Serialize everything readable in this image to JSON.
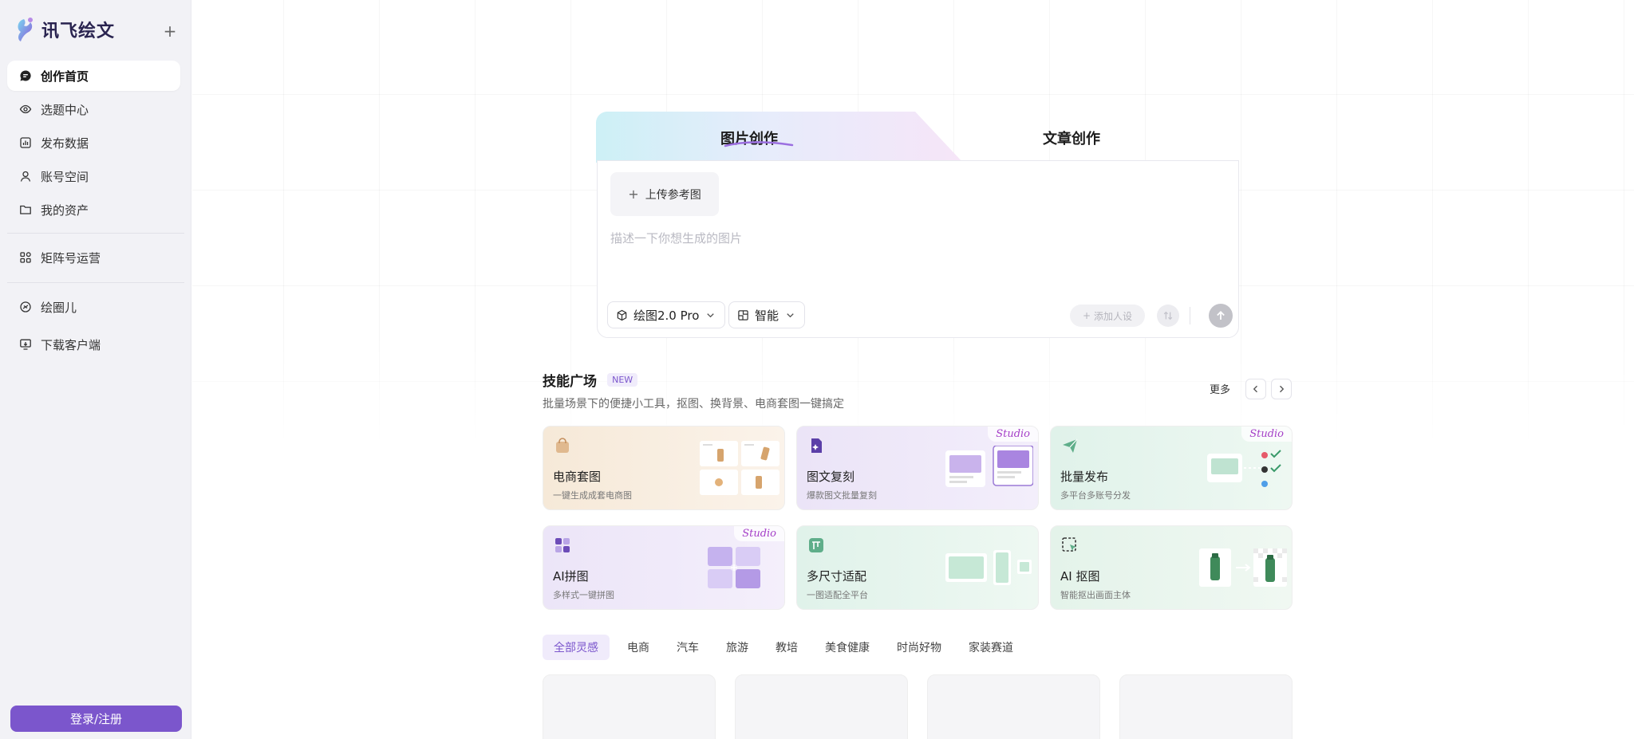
{
  "brand": {
    "name": "讯飞绘文",
    "accent": "#7b56cc"
  },
  "sidebar": {
    "new_button_icon": "plus-icon",
    "items": [
      {
        "label": "创作首页",
        "icon": "chat-bubble-icon",
        "active": true
      },
      {
        "label": "选题中心",
        "icon": "eye-target-icon"
      },
      {
        "label": "发布数据",
        "icon": "bar-chart-icon"
      },
      {
        "label": "账号空间",
        "icon": "user-icon"
      },
      {
        "label": "我的资产",
        "icon": "folder-icon"
      },
      {
        "label": "矩阵号运营",
        "icon": "grid-apps-icon"
      },
      {
        "label": "绘圈儿",
        "icon": "circle-chat-icon"
      },
      {
        "label": "下载客户端",
        "icon": "monitor-download-icon"
      }
    ],
    "login_label": "登录/注册"
  },
  "composer": {
    "tabs": [
      {
        "label": "图片创作",
        "active": true
      },
      {
        "label": "文章创作",
        "active": false
      }
    ],
    "upload_label": "上传参考图",
    "prompt_placeholder": "描述一下你想生成的图片",
    "model_label": "绘图2.0 Pro",
    "ratio_label": "智能",
    "persona_label": "添加人设"
  },
  "skills": {
    "title": "技能广场",
    "badge": "NEW",
    "subtitle": "批量场景下的便捷小工具，抠图、换背景、电商套图一键搞定",
    "more_label": "更多",
    "cards": [
      {
        "title": "电商套图",
        "desc": "一键生成成套电商图",
        "studio": "",
        "bg": "#f6ebdd"
      },
      {
        "title": "图文复刻",
        "desc": "爆款图文批量复刻",
        "studio": "Studio",
        "bg": "#ece6f7"
      },
      {
        "title": "批量发布",
        "desc": "多平台多账号分发",
        "studio": "Studio",
        "bg": "#e3f3ec"
      },
      {
        "title": "AI拼图",
        "desc": "多样式一键拼图",
        "studio": "Studio",
        "bg": "#eee8f8"
      },
      {
        "title": "多尺寸适配",
        "desc": "一图适配全平台",
        "studio": "",
        "bg": "#e3f3ec"
      },
      {
        "title": "AI 抠图",
        "desc": "智能抠出画面主体",
        "studio": "",
        "bg": "#e6f4ea"
      }
    ]
  },
  "categories": [
    "全部灵感",
    "电商",
    "汽车",
    "旅游",
    "教培",
    "美食健康",
    "时尚好物",
    "家装赛道"
  ]
}
